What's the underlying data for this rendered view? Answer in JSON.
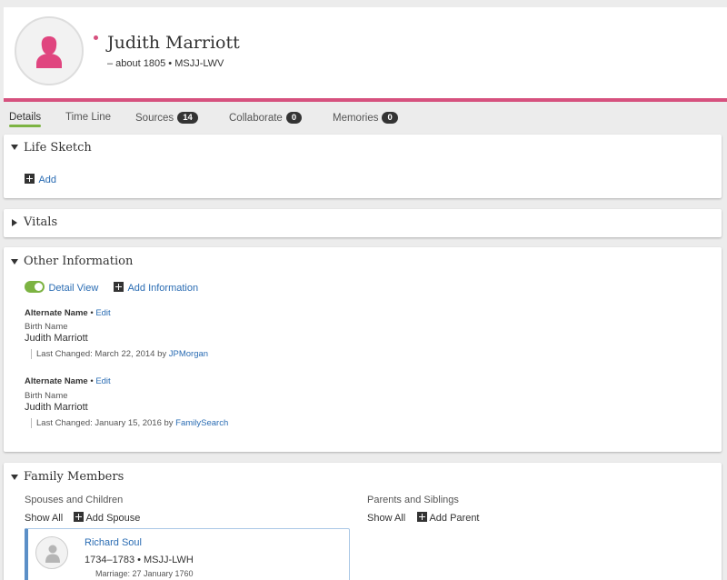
{
  "person": {
    "name": "Judith Marriott",
    "subtitle": "– about 1805 • MSJJ-LWV",
    "gender_color": "#d6517e"
  },
  "tabs": [
    {
      "label": "Details",
      "active": true
    },
    {
      "label": "Time Line"
    },
    {
      "label": "Sources",
      "count": "14"
    },
    {
      "label": "Collaborate",
      "count": "0"
    },
    {
      "label": "Memories",
      "count": "0"
    }
  ],
  "life_sketch": {
    "title": "Life Sketch",
    "add_label": "Add"
  },
  "vitals": {
    "title": "Vitals"
  },
  "other_info": {
    "title": "Other Information",
    "detail_view_label": "Detail View",
    "add_info_label": "Add Information",
    "entries": [
      {
        "label": "Alternate Name",
        "separator": "•",
        "edit": "Edit",
        "type": "Birth Name",
        "value": "Judith Marriott",
        "changed_prefix": "Last Changed: March 22, 2014 by",
        "changed_by": "JPMorgan"
      },
      {
        "label": "Alternate Name",
        "separator": "•",
        "edit": "Edit",
        "type": "Birth Name",
        "value": "Judith Marriott",
        "changed_prefix": "Last Changed: January 15, 2016 by",
        "changed_by": "FamilySearch"
      }
    ]
  },
  "family": {
    "title": "Family Members",
    "spouses_heading": "Spouses and Children",
    "parents_heading": "Parents and Siblings",
    "show_all": "Show All",
    "add_spouse": "Add Spouse",
    "add_parent": "Add Parent",
    "spouse": {
      "name": "Richard Soul",
      "dates": "1734–1783 • MSJJ-LWH",
      "marriage": "Marriage: 27 January 1760"
    }
  },
  "colors": {
    "accent_pink": "#d6517e",
    "active_tab_green": "#7cb342",
    "link_blue": "#2a6cb3"
  }
}
